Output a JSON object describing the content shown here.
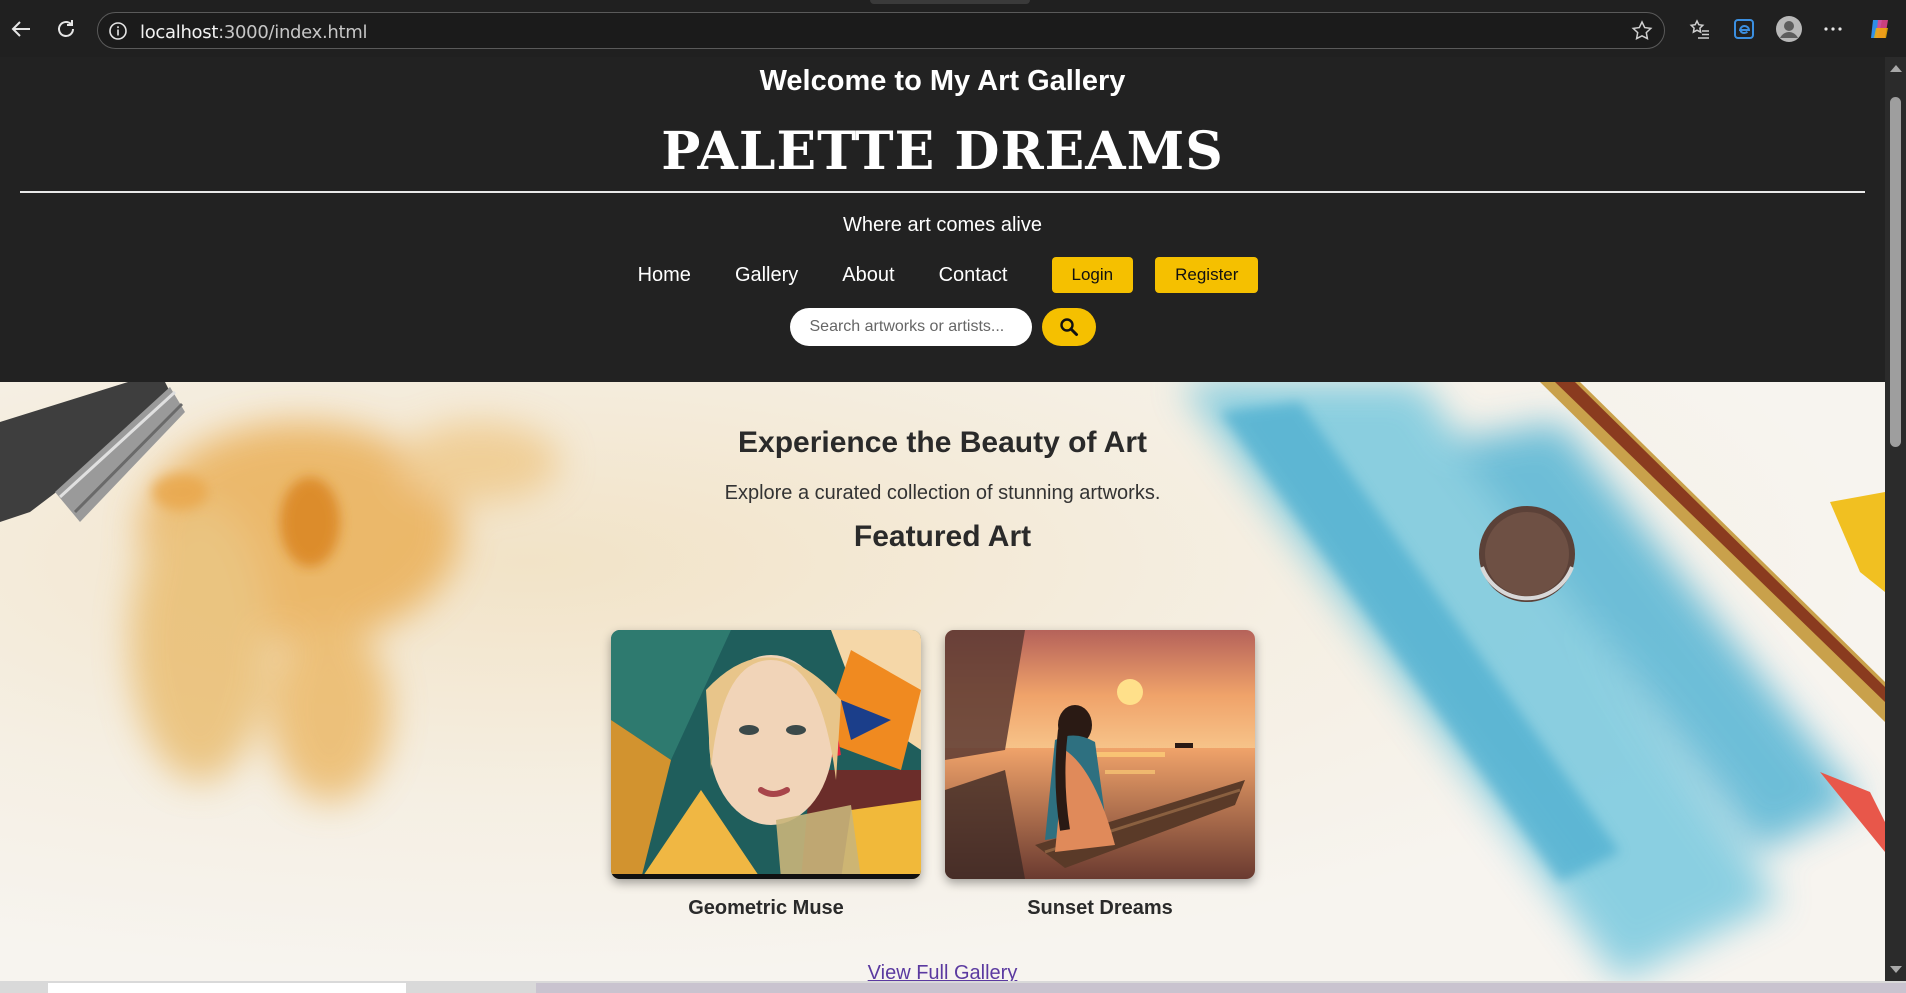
{
  "browser": {
    "url_host": "localhost",
    "url_rest": ":3000/index.html"
  },
  "header": {
    "welcome": "Welcome to My Art Gallery",
    "brand": "PALETTE DREAMS",
    "tagline": "Where art comes alive",
    "nav": {
      "home": "Home",
      "gallery": "Gallery",
      "about": "About",
      "contact": "Contact"
    },
    "login": "Login",
    "register": "Register",
    "search_placeholder": "Search artworks or artists..."
  },
  "hero": {
    "title": "Experience the Beauty of Art",
    "subtitle": "Explore a curated collection of stunning artworks.",
    "featured_heading": "Featured Art",
    "artworks": [
      {
        "caption": "Geometric Muse"
      },
      {
        "caption": "Sunset Dreams"
      }
    ],
    "view_all": "View Full Gallery"
  },
  "colors": {
    "accent": "#f5c000",
    "header_bg": "#222222"
  }
}
